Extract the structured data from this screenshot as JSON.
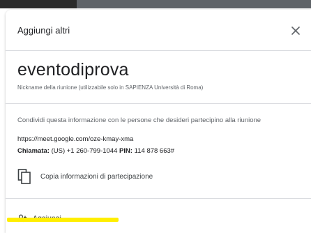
{
  "dialog": {
    "title": "Aggiungi altri",
    "close_icon": "close-icon"
  },
  "meeting": {
    "name": "eventodiprova",
    "nickname_note": "Nickname della riunione (utilizzabile solo in SAPIENZA Università di Roma)"
  },
  "join_info": {
    "share_text": "Condividi questa informazione con le persone che desideri partecipino alla riunione",
    "link": "https://meet.google.com/oze-kmay-xma",
    "call_label": "Chiamata:",
    "call_number": " (US) +1 260-799-1044  ",
    "pin_label": "PIN:",
    "pin_value": " 114 878 663#"
  },
  "actions": {
    "copy_label": "Copia informazioni di partecipazione",
    "copy_icon": "copy-icon",
    "add_label": "Aggiungi",
    "add_icon": "person-add-icon"
  },
  "colors": {
    "highlight": "#ffee00",
    "text_primary": "#202124",
    "text_secondary": "#5f6368",
    "divider": "#dadce0"
  }
}
